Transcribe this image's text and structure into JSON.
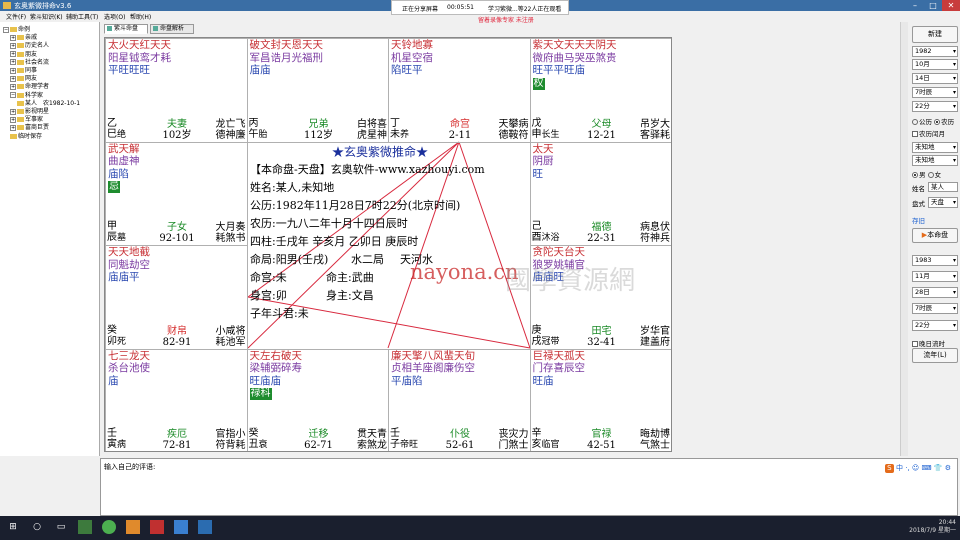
{
  "window": {
    "title": "玄奥紫微排命v3.6"
  },
  "share": {
    "status": "正在分享屏幕",
    "timer": "00:05:51",
    "viewers": "学习紫微...等22人正在观看",
    "notice": "留着录像专家 未注册"
  },
  "menu": [
    "文件(F)",
    "紫斗知识(K)",
    "辅助工具(T)",
    "选项(O)",
    "帮助(H)"
  ],
  "tree": [
    {
      "label": "命例",
      "level": 0,
      "box": "⊟"
    },
    {
      "label": "亲戚",
      "level": 1,
      "box": "⊞"
    },
    {
      "label": "历史名人",
      "level": 1,
      "box": "⊞"
    },
    {
      "label": "朋友",
      "level": 1,
      "box": "⊞"
    },
    {
      "label": "社会名流",
      "level": 1,
      "box": "⊞"
    },
    {
      "label": "同事",
      "level": 1,
      "box": "⊞"
    },
    {
      "label": "网友",
      "level": 1,
      "box": "⊞"
    },
    {
      "label": "命理学者",
      "level": 1,
      "box": "⊞"
    },
    {
      "label": "科学家",
      "level": 1,
      "box": "⊟"
    },
    {
      "label": "某人",
      "level": 2,
      "box": "",
      "extra": "农1982-10-1"
    },
    {
      "label": "影视明星",
      "level": 1,
      "box": "⊞"
    },
    {
      "label": "军事家",
      "level": 1,
      "box": "⊞"
    },
    {
      "label": "富商巨贾",
      "level": 1,
      "box": "⊞"
    },
    {
      "label": "临时保存",
      "level": 1,
      "box": ""
    }
  ],
  "tabs": [
    "紫斗命盘",
    "命盘解析"
  ],
  "palaces": [
    {
      "id": "si",
      "r1": "太火天红天天",
      "r2": "阳星钺鸾才耗",
      "r3": "平旺旺旺",
      "badge": "",
      "stem": "乙巳",
      "stage": "绝",
      "name": "夫妻",
      "age": "102岁",
      "red": false,
      "gods": "龙亡飞\n德神廉"
    },
    {
      "id": "wu",
      "r1": "破文封天恩天天",
      "r2": "军昌诰月光福刑",
      "r3": "庙庙",
      "badge": "",
      "stem": "丙午",
      "stage": "胎",
      "name": "兄弟",
      "age": "112岁",
      "red": false,
      "gods": "白将喜\n虎星神"
    },
    {
      "id": "wei",
      "r1": "天铃地寡",
      "r2": "机星空宿",
      "r3": "陷旺平",
      "badge": "",
      "stem": "丁未",
      "stage": "养",
      "name": "命宫",
      "age": "2-11",
      "red": true,
      "gods": "天攀病\n德鞍符"
    },
    {
      "id": "shen",
      "r1": "紫天文天天天阴天",
      "r2": "微府曲马哭巫煞贵",
      "r3": "旺平平旺庙",
      "badge": "权",
      "stem": "戊申",
      "stage": "长生",
      "name": "父母",
      "age": "12-21",
      "red": false,
      "gods": "吊岁大\n客驿耗"
    },
    {
      "id": "chen",
      "r1": "武天解",
      "r2": "曲虚神",
      "r3": "庙陷",
      "badge": "忌",
      "stem": "甲辰",
      "stage": "墓",
      "name": "子女",
      "age": "92-101",
      "red": false,
      "gods": "大月奏\n耗煞书"
    },
    {
      "id": "you",
      "r1": "太天",
      "r2": "阴厨",
      "r3": "旺",
      "badge": "",
      "stem": "己酉",
      "stage": "沐浴",
      "name": "福德",
      "age": "22-31",
      "red": false,
      "gods": "病息伏\n符神兵"
    },
    {
      "id": "mao",
      "r1": "天天地截",
      "r2": "同魁劫空",
      "r3": "庙庙平",
      "badge": "",
      "stem": "癸卯",
      "stage": "死",
      "name": "财帛",
      "age": "82-91",
      "red": true,
      "gods": "小咸将\n耗池军"
    },
    {
      "id": "xu",
      "r1": "贪陀天台天",
      "r2": "狼罗姚辅官",
      "r3": "庙庙旺",
      "badge": "",
      "stem": "庚戌",
      "stage": "冠带",
      "name": "田宅",
      "age": "32-41",
      "red": false,
      "gods": "岁华官\n建盖府"
    },
    {
      "id": "yin",
      "r1": "七三龙天",
      "r2": "杀台池使",
      "r3": "庙",
      "badge": "",
      "stem": "壬寅",
      "stage": "病",
      "name": "疾厄",
      "age": "72-81",
      "red": false,
      "gods": "官指小\n符背耗"
    },
    {
      "id": "chou",
      "r1": "天左右破天",
      "r2": "梁辅弼碎寿",
      "r3": "旺庙庙",
      "badge": "禄科",
      "stem": "癸丑",
      "stage": "衰",
      "name": "迁移",
      "age": "62-71",
      "red": false,
      "gods": "贯天青\n索煞龙"
    },
    {
      "id": "zi",
      "r1": "廉天擎八风蜚天旬",
      "r2": "贞相羊座阁廉伤空",
      "r3": "平庙陷",
      "badge": "",
      "stem": "壬子",
      "stage": "帝旺",
      "name": "仆役",
      "age": "52-61",
      "red": false,
      "gods": "丧灾力\n门煞士"
    },
    {
      "id": "hai",
      "r1": "巨禄天孤天",
      "r2": "门存喜辰空",
      "r3": "旺庙",
      "badge": "",
      "stem": "辛亥",
      "stage": "临官",
      "name": "官禄",
      "age": "42-51",
      "red": false,
      "gods": "晦劫博\n气煞士"
    }
  ],
  "center": {
    "title": "★玄奥紫微推命★",
    "line1": "【本命盘-天盘】玄奥软件-www.xazhouyi.com",
    "line2": "姓名:某人,未知地",
    "line3": "公历:1982年11月28日7时22分(北京时间)",
    "line4": "农历:一九八二年十月十四日辰时",
    "line5": "四柱:壬戌年 辛亥月 乙卯日 庚辰时",
    "line6a": "命局:阳男(壬戌)",
    "line6b": "水二局",
    "line6c": "天河水",
    "line7a": "命宫:未",
    "line7b": "命主:武曲",
    "line8a": "身宫:卯",
    "line8b": "身主:文昌",
    "line9": "子年斗君:未",
    "watermark": "nayona.cn",
    "watermark2": "國學資源網"
  },
  "right": {
    "new_btn": "新建",
    "year": "1982",
    "month": "10月",
    "day": "14日",
    "hour": "7时辰",
    "minute": "22分",
    "cal_solar": "公历",
    "cal_lunar": "农历",
    "leap": "农历闰月",
    "place1": "未知地",
    "place2": "未知地",
    "male": "男",
    "female": "女",
    "name_label": "姓名",
    "name_value": "某人",
    "chart_label": "盘式",
    "chart_value": "天盘",
    "save": "存旧",
    "natal_btn": "本命盘",
    "flow_year": "1983",
    "flow_month": "11月",
    "flow_day": "28日",
    "flow_hour": "7时辰",
    "flow_minute": "22分",
    "late_night": "晚日流时",
    "flow_btn": "流年(L)"
  },
  "comment": {
    "label": "输入自己的评语:",
    "ime": "中 ·, ☺ ⌨ 👕 ⚙"
  },
  "taskbar": {
    "time": "20:44",
    "date": "2018/7/9 星期一"
  },
  "colors": {
    "title": "#3a6ea5",
    "star_main": "#c72f34",
    "star_minor": "#7a3aa0",
    "brightness": "#2a48b0",
    "badge": "#1e8c2e",
    "palace_name": "#1a8a26",
    "palace_life": "#d62f2f",
    "center_title": "#1a2f9c",
    "triangle": "#d8293e"
  }
}
